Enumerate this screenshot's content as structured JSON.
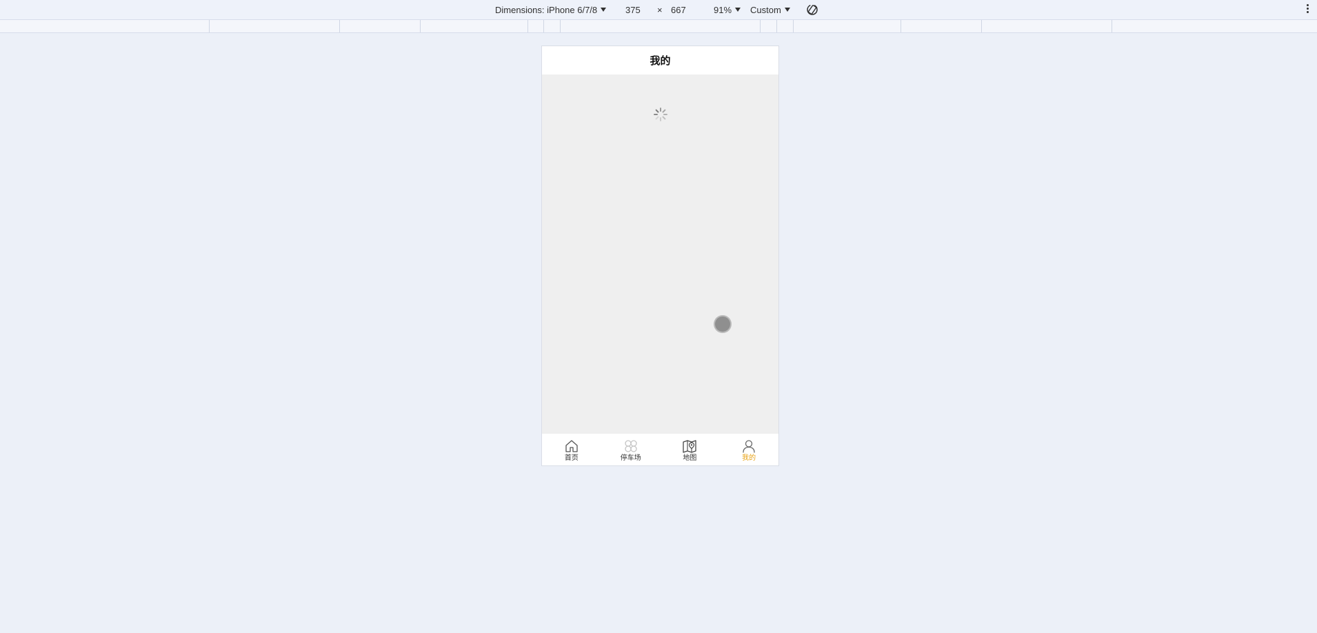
{
  "devtools": {
    "dimensions_label": "Dimensions: iPhone 6/7/8",
    "width": "375",
    "times": "×",
    "height": "667",
    "zoom": "91%",
    "throttling": "Custom"
  },
  "page": {
    "title": "我的"
  },
  "tabbar": {
    "active_color": "#e8a317",
    "items": [
      {
        "label": "首页",
        "icon": "home-icon"
      },
      {
        "label": "停车场",
        "icon": "parking-grid-icon"
      },
      {
        "label": "地图",
        "icon": "map-icon"
      },
      {
        "label": "我的",
        "icon": "user-icon",
        "active": true
      }
    ]
  }
}
